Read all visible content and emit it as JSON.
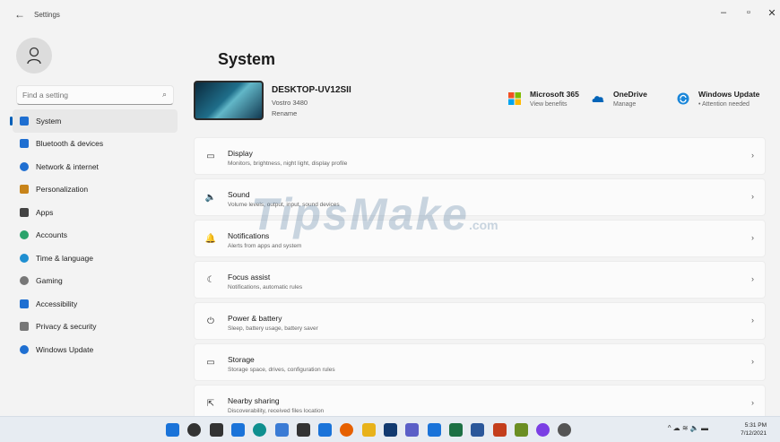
{
  "window": {
    "title": "Settings",
    "back_glyph": "←",
    "minimize_glyph": "–",
    "maximize_glyph": "▫",
    "close_glyph": "✕"
  },
  "search": {
    "placeholder": "Find a setting"
  },
  "sidebar": {
    "items": [
      {
        "label": "System",
        "icon": "monitor-icon",
        "color": "#1f6fd1",
        "active": true
      },
      {
        "label": "Bluetooth & devices",
        "icon": "bluetooth-icon",
        "color": "#1f6fd1"
      },
      {
        "label": "Network & internet",
        "icon": "wifi-icon",
        "color": "#1f6fd1"
      },
      {
        "label": "Personalization",
        "icon": "brush-icon",
        "color": "#c8841a"
      },
      {
        "label": "Apps",
        "icon": "apps-icon",
        "color": "#444444"
      },
      {
        "label": "Accounts",
        "icon": "person-icon",
        "color": "#2aa36b"
      },
      {
        "label": "Time & language",
        "icon": "globe-clock-icon",
        "color": "#1f8fd1"
      },
      {
        "label": "Gaming",
        "icon": "gamepad-icon",
        "color": "#777777"
      },
      {
        "label": "Accessibility",
        "icon": "accessibility-icon",
        "color": "#1f6fd1"
      },
      {
        "label": "Privacy & security",
        "icon": "shield-icon",
        "color": "#777777"
      },
      {
        "label": "Windows Update",
        "icon": "update-icon",
        "color": "#1f6fd1"
      }
    ]
  },
  "main": {
    "title": "System",
    "device": {
      "name": "DESKTOP-UV12SII",
      "model": "Vostro 3480",
      "rename": "Rename"
    },
    "promos": [
      {
        "title": "Microsoft 365",
        "sub": "View benefits",
        "icon": "microsoft-365-icon"
      },
      {
        "title": "OneDrive",
        "sub": "Manage",
        "icon": "onedrive-cloud-icon"
      },
      {
        "title": "Windows Update",
        "sub": "• Attention needed",
        "icon": "windows-update-icon"
      }
    ],
    "cards": [
      {
        "title": "Display",
        "sub": "Monitors, brightness, night light, display profile",
        "icon": "display-icon",
        "glyph": "▭"
      },
      {
        "title": "Sound",
        "sub": "Volume levels, output, input, sound devices",
        "icon": "speaker-icon",
        "glyph": "🔈"
      },
      {
        "title": "Notifications",
        "sub": "Alerts from apps and system",
        "icon": "bell-icon",
        "glyph": "🔔"
      },
      {
        "title": "Focus assist",
        "sub": "Notifications, automatic rules",
        "icon": "moon-icon",
        "glyph": "☾"
      },
      {
        "title": "Power & battery",
        "sub": "Sleep, battery usage, battery saver",
        "icon": "power-icon",
        "glyph": "⏻"
      },
      {
        "title": "Storage",
        "sub": "Storage space, drives, configuration rules",
        "icon": "storage-icon",
        "glyph": "▭"
      },
      {
        "title": "Nearby sharing",
        "sub": "Discoverability, received files location",
        "icon": "share-icon",
        "glyph": "⇱"
      }
    ],
    "chevron": "›"
  },
  "watermark": {
    "text": "TipsMake",
    "suffix": ".com"
  },
  "taskbar": {
    "apps": [
      "windows-start-icon",
      "search-icon",
      "task-view-icon",
      "widgets-icon",
      "edge-icon",
      "photos-icon",
      "store-icon",
      "mail-icon",
      "firefox-icon",
      "paint-icon",
      "photoshop-icon",
      "teams-icon",
      "notepad-icon",
      "excel-icon",
      "word-icon",
      "powerpoint-icon",
      "snip-icon",
      "messenger-icon",
      "settings-icon"
    ],
    "tray": "^ ☁ ≋ 🔈 ▬",
    "time": "5:31 PM",
    "date": "7/12/2021"
  }
}
